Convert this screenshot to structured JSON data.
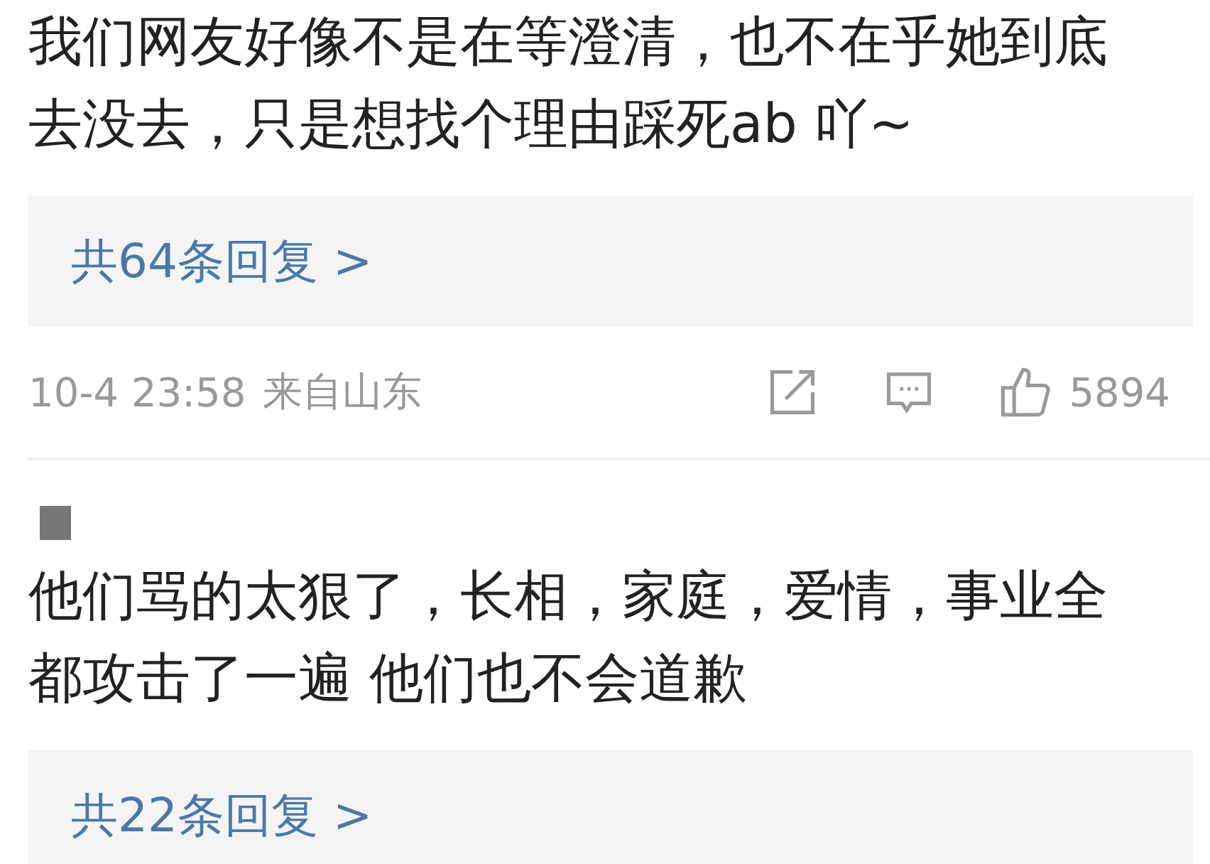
{
  "comments": [
    {
      "text_lines": [
        "我们网友好像不是在等澄清，也不在乎她到底",
        "去没去，只是想找个理由踩死ab 吖~"
      ],
      "replies": "共64条回复 >",
      "meta": {
        "time": "10-4 23:58",
        "location": "来自山东",
        "likes": "5894"
      }
    },
    {
      "author_redacted": true,
      "text_lines": [
        "他们骂的太狠了，长相，家庭，爱情，事业全",
        "都攻击了一遍 他们也不会道歉"
      ],
      "replies": "共22条回复 >"
    }
  ]
}
